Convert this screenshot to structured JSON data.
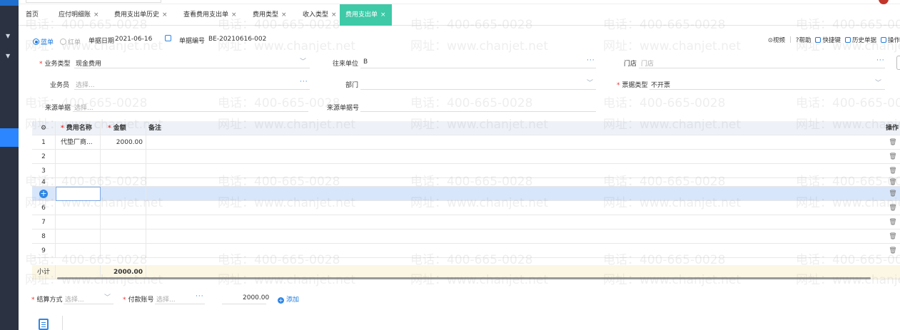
{
  "tabs": [
    {
      "label": "首页",
      "closable": false
    },
    {
      "label": "应付明细账",
      "closable": true
    },
    {
      "label": "费用支出单历史",
      "closable": true
    },
    {
      "label": "查看费用支出单",
      "closable": true
    },
    {
      "label": "费用类型",
      "closable": true
    },
    {
      "label": "收入类型",
      "closable": true
    },
    {
      "label": "费用支出单",
      "closable": true,
      "active": true
    }
  ],
  "close_glyph": "×",
  "header": {
    "radio_blue": "蓝单",
    "radio_red": "红单",
    "date_label": "单据日期",
    "date_value": "2021-06-16",
    "number_label": "单据编号",
    "number_value": "BE-20210616-002",
    "tools": {
      "video": "视频",
      "help": "帮助",
      "shortcut": "快捷键",
      "history": "历史单据",
      "more": "操作"
    }
  },
  "form": {
    "biz_type_label": "业务类型",
    "biz_type_value": "现金费用",
    "partner_label": "往来单位",
    "partner_value": "B",
    "store_label": "门店",
    "store_placeholder": "门店",
    "salesman_label": "业务员",
    "salesman_placeholder": "选择...",
    "dept_label": "部门",
    "dept_value": "",
    "invoice_label": "票据类型",
    "invoice_value": "不开票",
    "source_label": "来源单据",
    "source_placeholder": "选择...",
    "source_no_label": "来源单据号",
    "source_no_value": ""
  },
  "grid": {
    "columns": {
      "settings_icon": "gear-icon",
      "name": "费用名称",
      "amount": "金额",
      "remark": "备注",
      "op": "操作"
    },
    "rows": [
      {
        "no": "1",
        "name": "代垫厂商...",
        "amount": "2000.00",
        "remark": ""
      },
      {
        "no": "2",
        "name": "",
        "amount": "",
        "remark": ""
      },
      {
        "no": "3",
        "name": "",
        "amount": "",
        "remark": ""
      },
      {
        "no": "4",
        "name": "",
        "amount": "",
        "remark": ""
      },
      {
        "no": "+",
        "name": "",
        "amount": "",
        "remark": ""
      },
      {
        "no": "6",
        "name": "",
        "amount": "",
        "remark": ""
      },
      {
        "no": "7",
        "name": "",
        "amount": "",
        "remark": ""
      },
      {
        "no": "8",
        "name": "",
        "amount": "",
        "remark": ""
      },
      {
        "no": "9",
        "name": "",
        "amount": "",
        "remark": ""
      }
    ],
    "subtotal_label": "小计",
    "subtotal_amount": "2000.00",
    "delete_icon": "trash-icon"
  },
  "settlement": {
    "method_label": "结算方式",
    "method_placeholder": "选择...",
    "account_label": "付款账号",
    "account_placeholder": "选择...",
    "amount": "2000.00",
    "add_label": "添加"
  },
  "watermark": {
    "phone": "电话：400-665-0028",
    "site": "网址：www.chanjet.net"
  },
  "colors": {
    "accent": "#3ec9a7",
    "primary": "#2e86e6",
    "sidebar": "#2b3242",
    "required": "#e33333",
    "selected_row": "#d7e6fb",
    "subtotal_row": "#fcf7e5"
  }
}
